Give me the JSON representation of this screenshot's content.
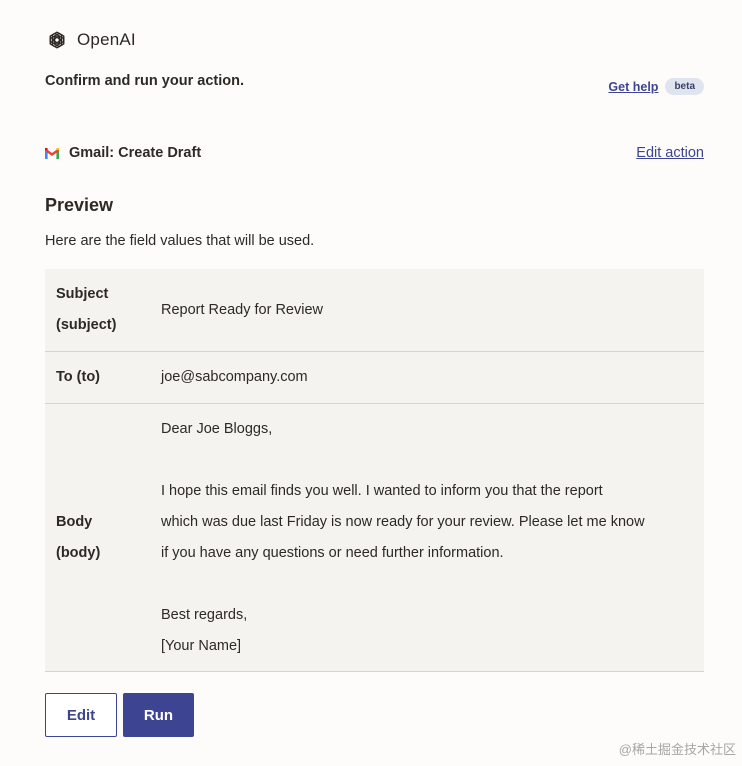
{
  "brand": {
    "name": "OpenAI",
    "icon": "openai-logo-icon"
  },
  "confirm_text": "Confirm and run your action.",
  "help": {
    "label": "Get help",
    "badge": "beta"
  },
  "action": {
    "icon": "gmail-icon",
    "title": "Gmail: Create Draft",
    "edit_label": "Edit action"
  },
  "preview": {
    "heading": "Preview",
    "subtext": "Here are the field values that will be used.",
    "fields": {
      "subject": {
        "label_line1": "Subject",
        "label_line2": "(subject)",
        "value": "Report Ready for Review"
      },
      "to": {
        "label": "To (to)",
        "value": "joe@sabcompany.com"
      },
      "body": {
        "label_line1": "Body",
        "label_line2": "(body)",
        "greeting": "Dear Joe Bloggs,",
        "line1": "I hope this email finds you well. I wanted to inform you that the report",
        "line2": "which was due last Friday is now ready for your review. Please let me know",
        "line3": "if you have any questions or need further information.",
        "closing": "Best regards,",
        "signature": "[Your Name]"
      }
    }
  },
  "buttons": {
    "edit": "Edit",
    "run": "Run"
  },
  "watermark": "@稀土掘金技术社区",
  "colors": {
    "accent": "#3d4592",
    "background": "#fdfcfa",
    "table_bg": "#f4f3ef",
    "badge_bg": "#dfe4ee"
  }
}
